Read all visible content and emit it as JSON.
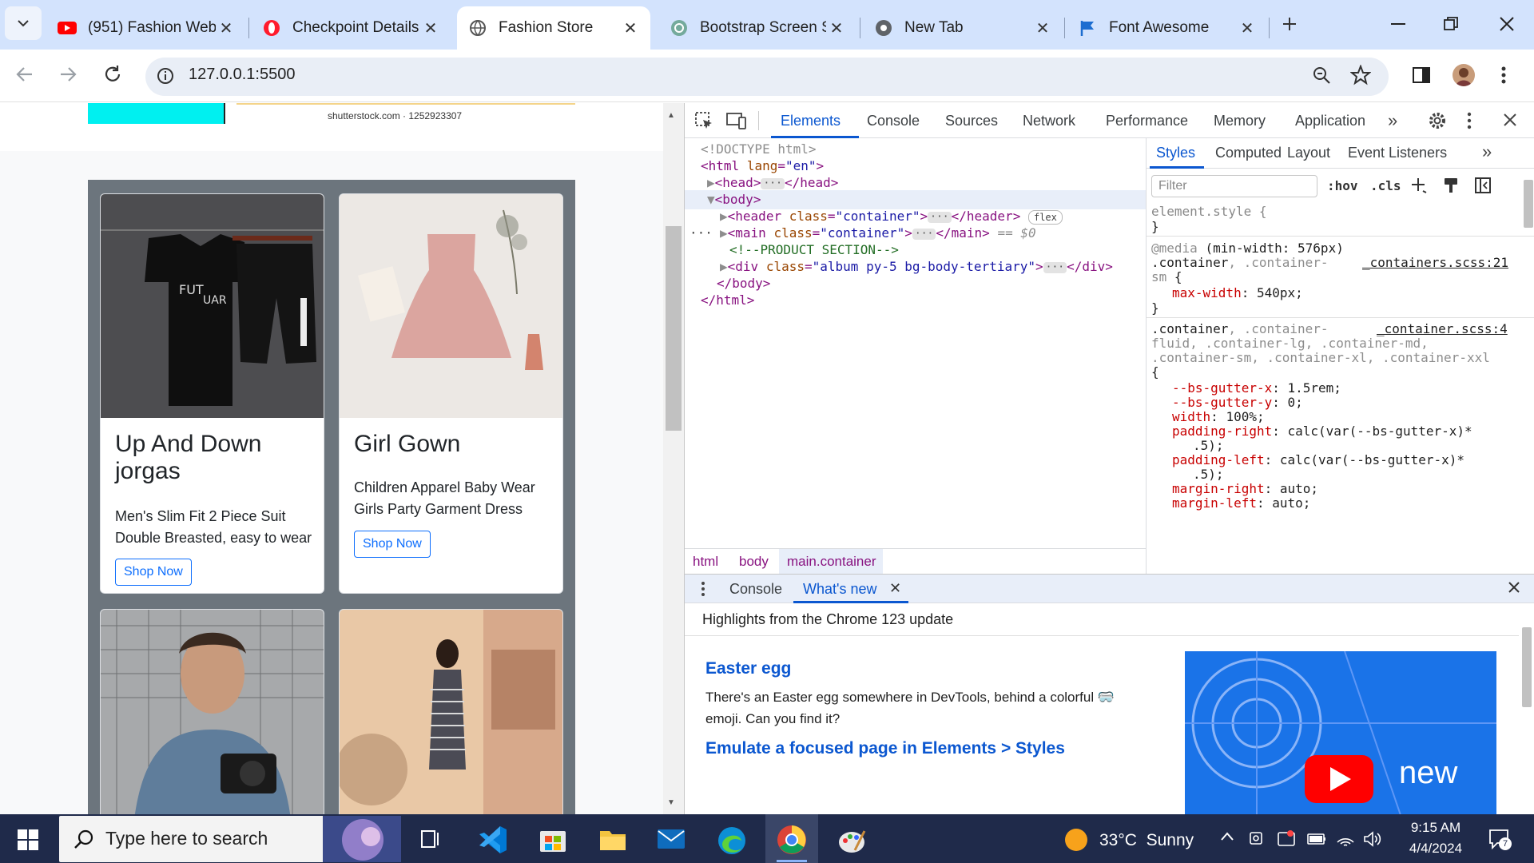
{
  "tabs": [
    {
      "title": "(951) Fashion Web",
      "icon": "youtube-icon",
      "active": false
    },
    {
      "title": "Checkpoint Details",
      "icon": "opera-icon",
      "active": false
    },
    {
      "title": "Fashion Store",
      "icon": "globe-icon",
      "active": true
    },
    {
      "title": "Bootstrap Screen S",
      "icon": "chatgpt-icon",
      "active": false
    },
    {
      "title": "New Tab",
      "icon": "chrome-icon",
      "active": false
    },
    {
      "title": "Font Awesome",
      "icon": "flag-icon",
      "active": false
    }
  ],
  "address": {
    "url": "127.0.0.1:5500"
  },
  "page": {
    "watermark": "shutterstock.com · 1252923307",
    "cards": [
      {
        "title": "Up And Down jorgas",
        "description": "Men's Slim Fit 2 Piece Suit Double Breasted, easy to wear",
        "button": "Shop Now"
      },
      {
        "title": "Girl Gown",
        "description": "Children Apparel Baby Wear Girls Party Garment Dress",
        "button": "Shop Now"
      }
    ]
  },
  "devtools": {
    "tabs": [
      "Elements",
      "Console",
      "Sources",
      "Network",
      "Performance",
      "Memory",
      "Application"
    ],
    "active_tab": "Elements",
    "dom": {
      "doctype": "<!DOCTYPE html>",
      "html_open_tag": "html",
      "html_attr": "lang",
      "html_attr_val": "\"en\"",
      "head": "head",
      "body": "body",
      "header_tag": "header",
      "class_attr": "class",
      "container_val": "\"container\"",
      "header_close": "</header>",
      "flex_badge": "flex",
      "main_tag": "main",
      "main_close": "</main>",
      "selected_marker": "== $0",
      "comment": "<!--PRODUCT SECTION-->",
      "div_tag": "div",
      "album_val": "\"album py-5 bg-body-tertiary\"",
      "div_close": "</div>",
      "body_close": "</body>",
      "html_close": "</html>"
    },
    "breadcrumbs": [
      "html",
      "body",
      "main.container"
    ],
    "styles_tabs": [
      "Styles",
      "Computed",
      "Layout",
      "Event Listeners"
    ],
    "filter_placeholder": "Filter",
    "hov": ":hov",
    "cls": ".cls",
    "rules": {
      "element_style": "element.style {",
      "close_brace": "}",
      "media": "@media",
      "media_query": "(min-width: 576px)",
      "r1_selector_main": ".container",
      "r1_selector_dim": ", .container-",
      "r1_selector_dim2": "sm",
      "r1_open": " {",
      "r1_source": "_containers.scss:21",
      "r1_prop": "max-width",
      "r1_val": "540px;",
      "r2_selector_main": ".container",
      "r2_selector_dim": ", .container-",
      "r2_line2": "fluid, .container-lg, .container-md,",
      "r2_line3": ".container-sm, .container-xl, .container-xxl",
      "r2_source": "_container.scss:4",
      "open_brace": "{",
      "decls": [
        {
          "prop": "--bs-gutter-x",
          "val": "1.5rem;"
        },
        {
          "prop": "--bs-gutter-y",
          "val": "0;"
        },
        {
          "prop": "width",
          "val": "100%;"
        },
        {
          "prop": "padding-right",
          "val": "calc(var(--bs-gutter-x)*"
        },
        {
          "prop": "",
          "val": ".5);"
        },
        {
          "prop": "padding-left",
          "val": "calc(var(--bs-gutter-x)*"
        },
        {
          "prop": "",
          "val": ".5);"
        },
        {
          "prop": "margin-right",
          "val": "auto;"
        },
        {
          "prop": "margin-left",
          "val": "auto;"
        }
      ]
    },
    "drawer": {
      "tabs": [
        "Console",
        "What's new"
      ],
      "highlights": "Highlights from the Chrome 123 update",
      "h1": "Easter egg",
      "p1": "There's an Easter egg somewhere in DevTools, behind a colorful 🥽 emoji. Can you find it?",
      "h2": "Emulate a focused page in Elements > Styles",
      "promo_text": "new"
    }
  },
  "taskbar": {
    "search_placeholder": "Type here to search",
    "weather": "33°C  Sunny",
    "time": "9:15 AM",
    "date": "4/4/2024",
    "notifications": "7"
  }
}
